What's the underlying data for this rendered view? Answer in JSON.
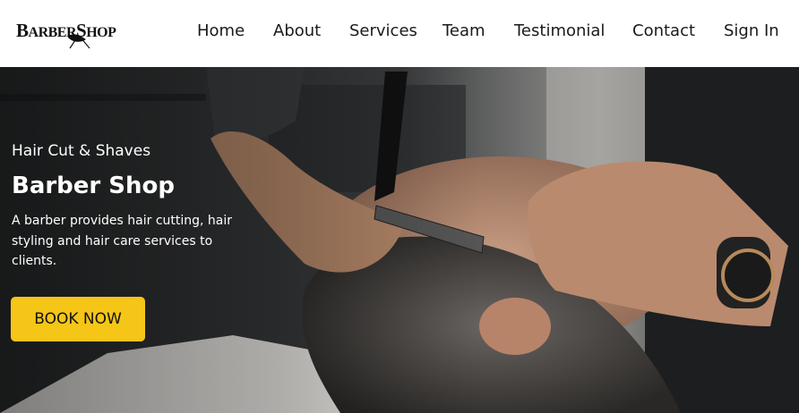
{
  "brand": {
    "logo_text_big1": "B",
    "logo_text_small1": "ARBER",
    "logo_text_big2": "S",
    "logo_text_small2": "HOP"
  },
  "nav": {
    "items": [
      {
        "label": "Home"
      },
      {
        "label": "About"
      },
      {
        "label": "Services"
      },
      {
        "label": "Team"
      },
      {
        "label": "Testimonial"
      },
      {
        "label": "Contact"
      },
      {
        "label": "Sign In"
      }
    ]
  },
  "hero": {
    "subtitle": "Hair Cut & Shaves",
    "title": "Barber Shop",
    "description": "A barber provides hair cutting, hair styling and hair care services to clients.",
    "cta_label": "BOOK NOW"
  },
  "colors": {
    "accent": "#f5c518",
    "header_bg": "#ffffff",
    "nav_text": "#1a1a1a"
  },
  "icons": {
    "logo": "barbershop-logo-mustache"
  }
}
